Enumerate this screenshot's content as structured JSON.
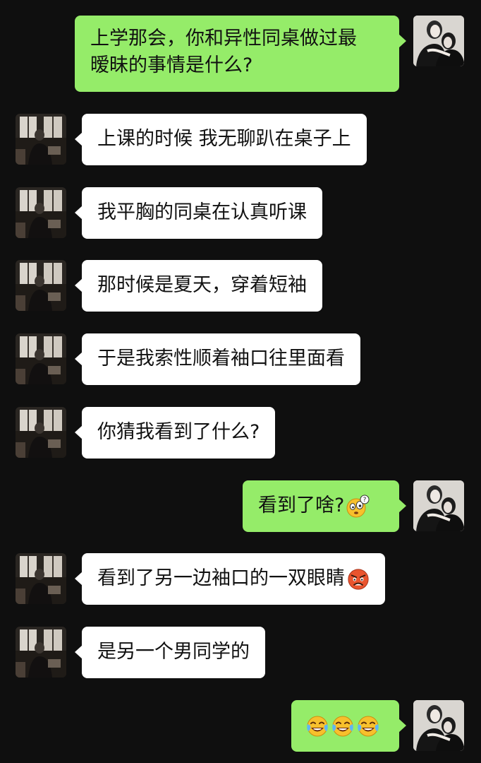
{
  "messages": [
    {
      "sender": "self",
      "text": "上学那会，你和异性同桌做过最暧昧的事情是什么?",
      "line1": "上学那会，你和异性同桌做过最",
      "line2": "暧昧的事情是什么?"
    },
    {
      "sender": "other",
      "text": "上课的时候 我无聊趴在桌子上"
    },
    {
      "sender": "other",
      "text": "我平胸的同桌在认真听课"
    },
    {
      "sender": "other",
      "text": "那时候是夏天，穿着短袖"
    },
    {
      "sender": "other",
      "text": "于是我索性顺着袖口往里面看"
    },
    {
      "sender": "other",
      "text": "你猜我看到了什么?"
    },
    {
      "sender": "self",
      "text": "看到了啥?",
      "emoji": "confused-face-emoji"
    },
    {
      "sender": "other",
      "text": "看到了另一边袖口的一双眼睛",
      "emoji": "angry-face-emoji"
    },
    {
      "sender": "other",
      "text": "是另一个男同学的"
    },
    {
      "sender": "self",
      "text": "",
      "emoji": "tears-of-joy-emoji",
      "emoji_count": 3
    }
  ],
  "colors": {
    "background": "#0f0f0f",
    "self_bubble": "#95ec69",
    "other_bubble": "#ffffff",
    "text": "#111111"
  },
  "avatars": {
    "self": "couple-photo-avatar",
    "other": "dark-room-figure-avatar"
  }
}
